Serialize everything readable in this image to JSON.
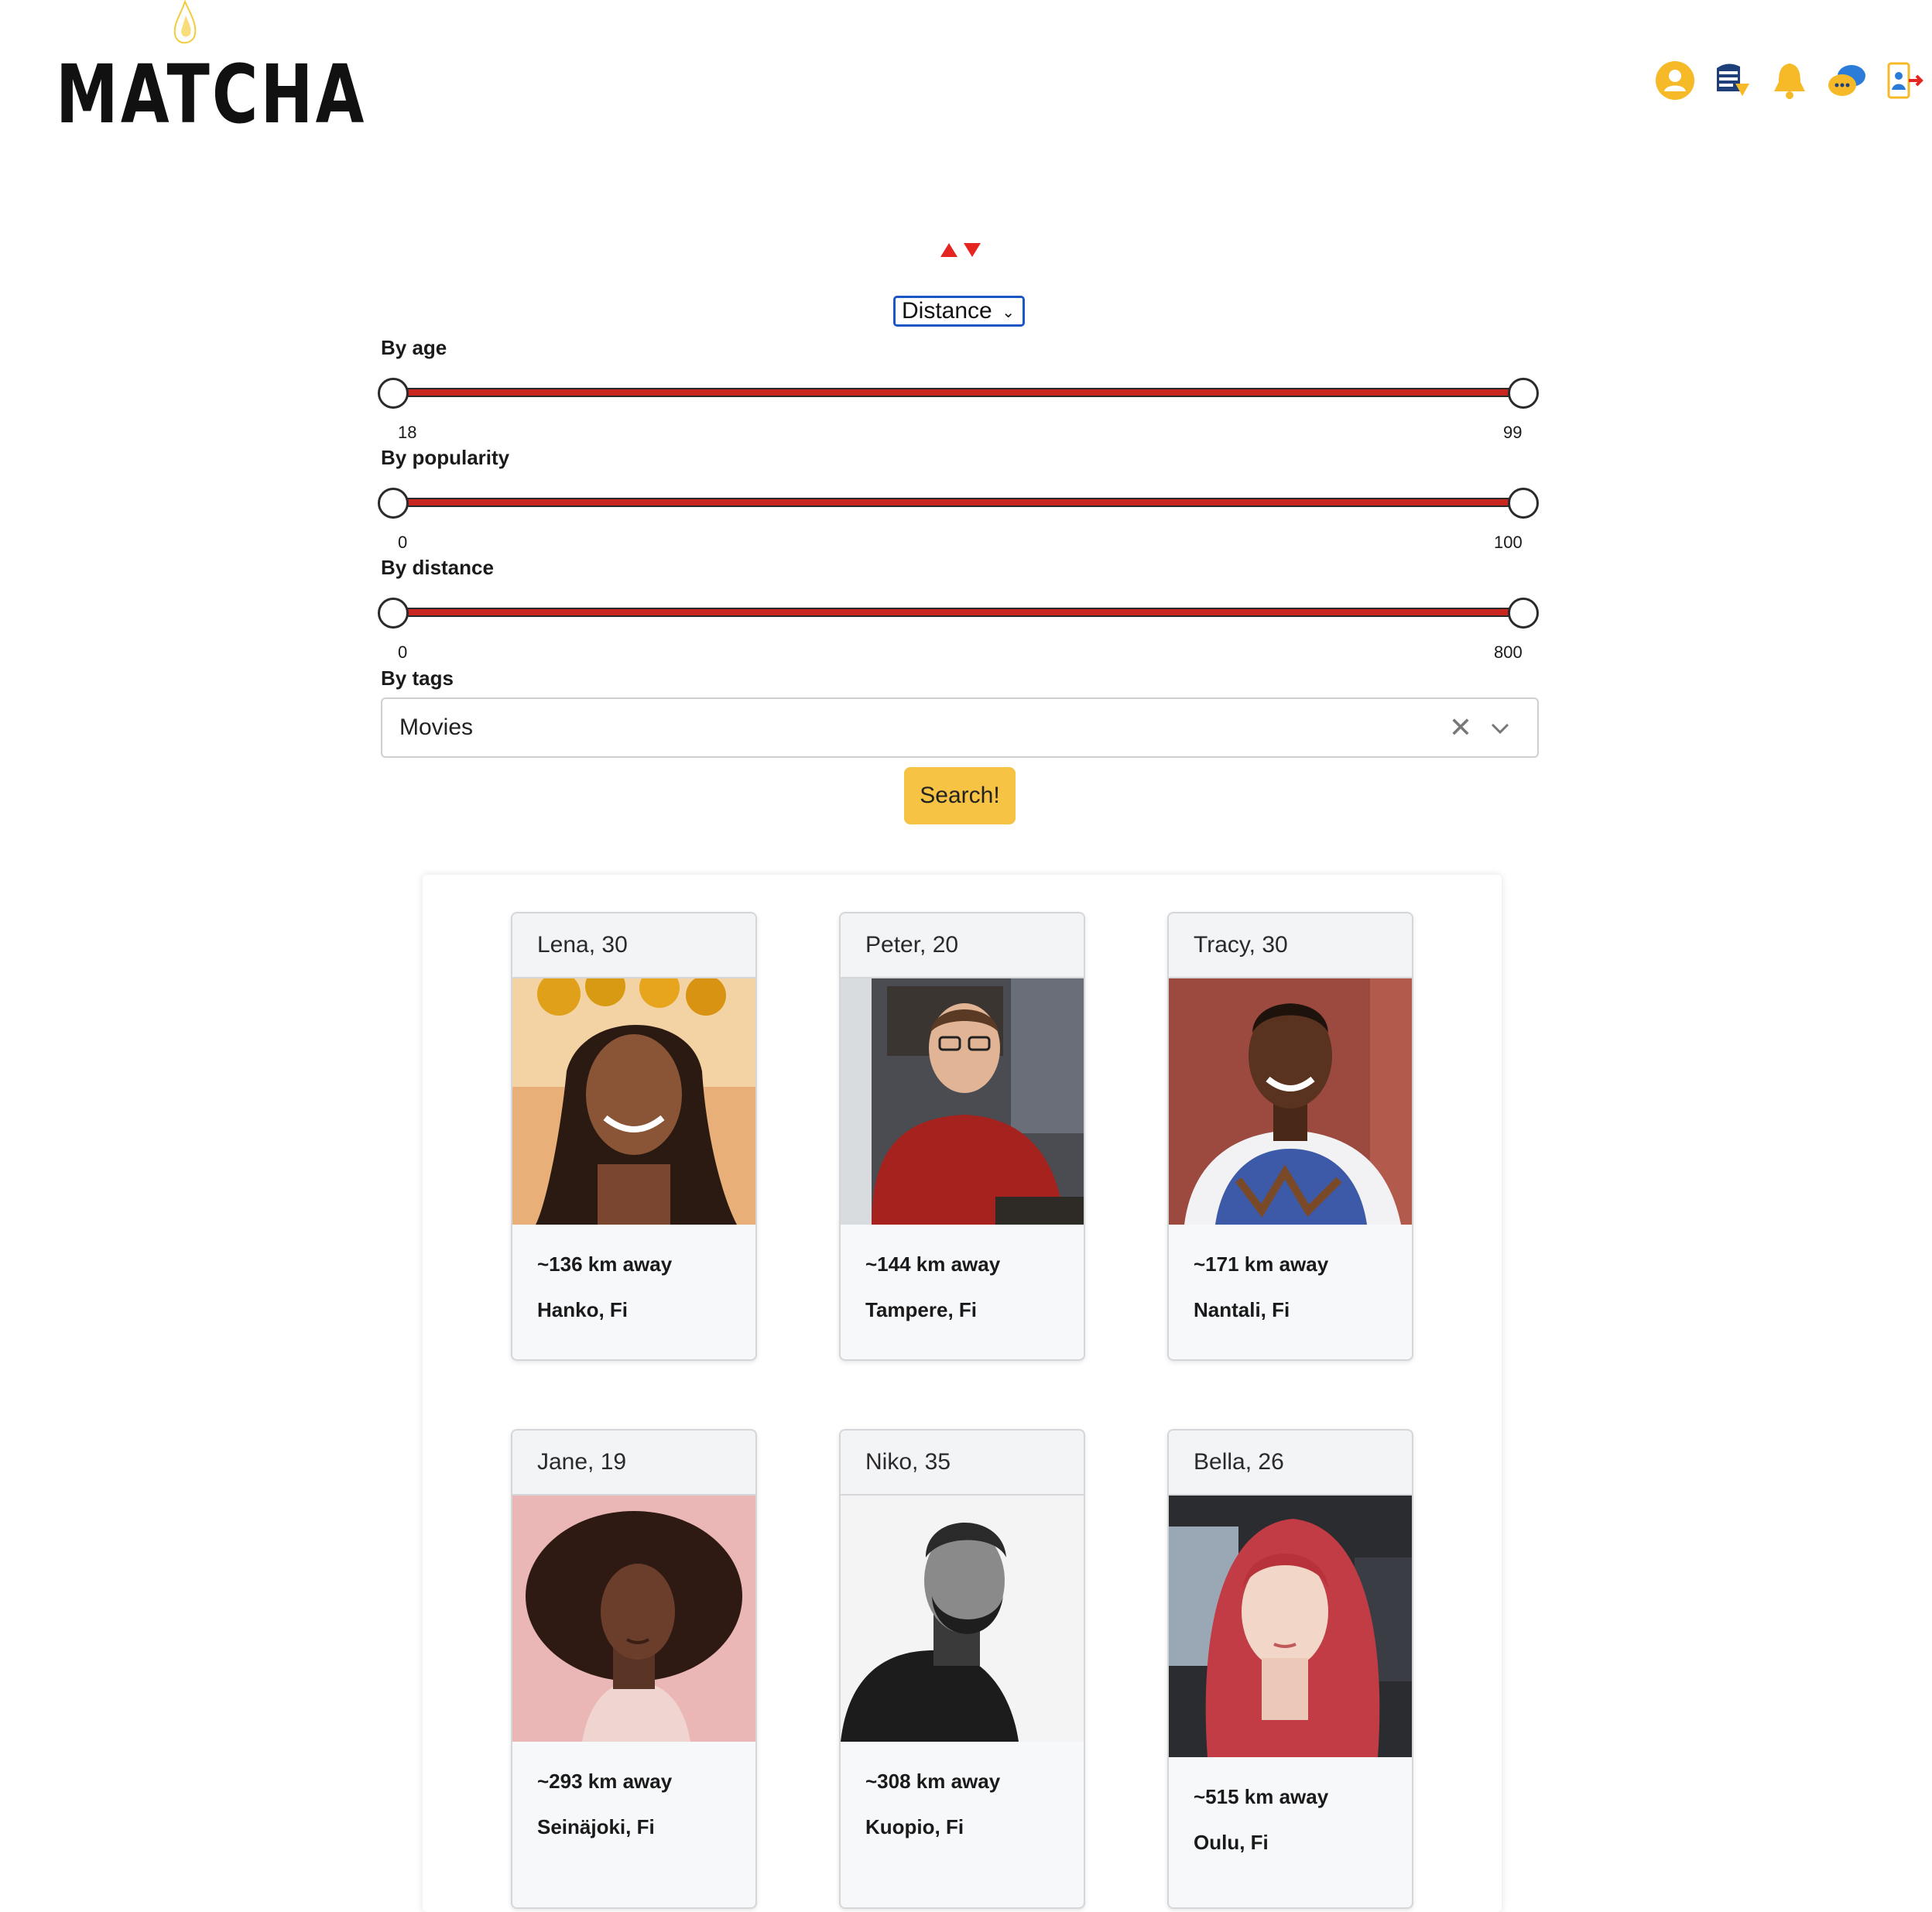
{
  "header": {
    "logo_text": "MATCHA",
    "nav_icons": [
      "profile-icon",
      "history-icon",
      "notifications-bell-icon",
      "chat-icon",
      "logout-icon"
    ]
  },
  "sort": {
    "selected": "Distance"
  },
  "filters": {
    "age": {
      "label": "By age",
      "min": "18",
      "max": "99"
    },
    "popularity": {
      "label": "By popularity",
      "min": "0",
      "max": "100"
    },
    "distance": {
      "label": "By distance",
      "min": "0",
      "max": "800"
    },
    "tags": {
      "label": "By tags",
      "value": "Movies"
    }
  },
  "search_button": "Search!",
  "colors": {
    "accent": "#f6c344",
    "slider_track": "#c8261e",
    "sort_arrows": "#e52620"
  },
  "profiles": [
    {
      "name": "Lena, 30",
      "distance": "~136 km away",
      "city": "Hanko, Fi"
    },
    {
      "name": "Peter, 20",
      "distance": "~144 km away",
      "city": "Tampere, Fi"
    },
    {
      "name": "Tracy, 30",
      "distance": "~171 km away",
      "city": "Nantali, Fi"
    },
    {
      "name": "Jane, 19",
      "distance": "~293 km away",
      "city": "Seinäjoki, Fi"
    },
    {
      "name": "Niko, 35",
      "distance": "~308 km away",
      "city": "Kuopio, Fi"
    },
    {
      "name": "Bella, 26",
      "distance": "~515 km away",
      "city": "Oulu, Fi"
    }
  ]
}
